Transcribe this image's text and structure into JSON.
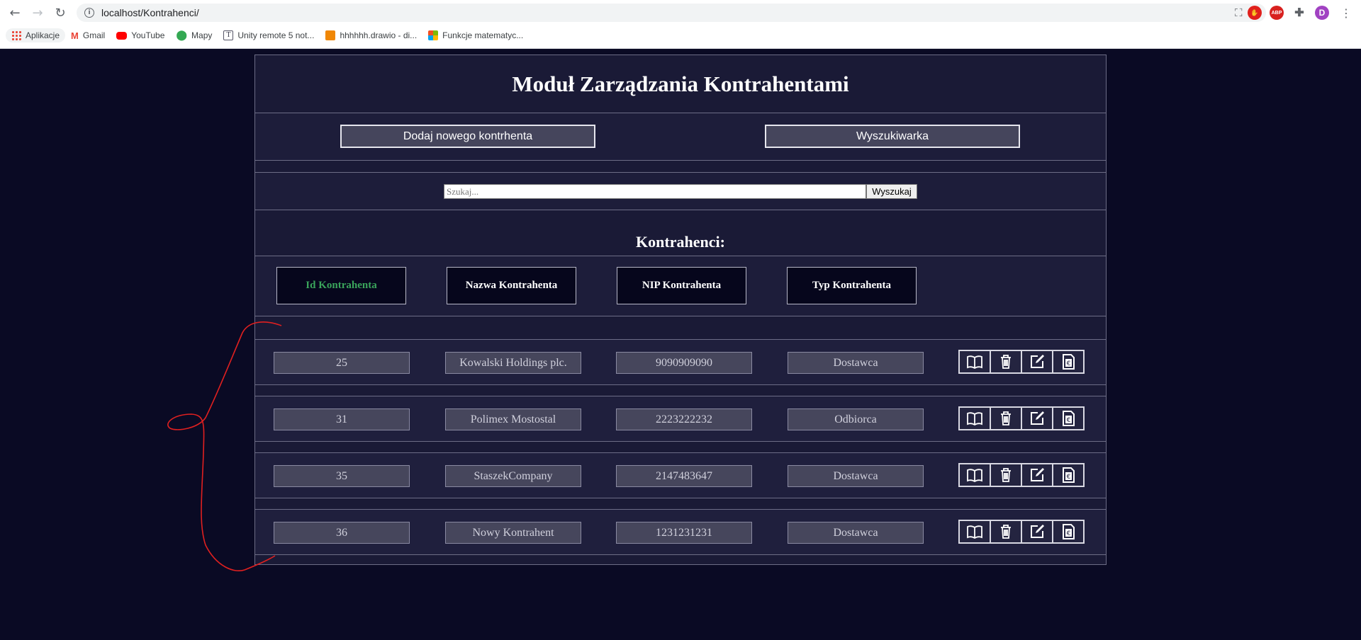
{
  "browser": {
    "url": "localhost/Kontrahenci/",
    "profile_initial": "D",
    "abp_label": "ABP",
    "bookmarks": [
      {
        "label": "Aplikacje"
      },
      {
        "label": "Gmail"
      },
      {
        "label": "YouTube"
      },
      {
        "label": "Mapy"
      },
      {
        "label": "Unity remote 5 not..."
      },
      {
        "label": "hhhhhh.drawio - di..."
      },
      {
        "label": "Funkcje matematyc..."
      }
    ]
  },
  "page": {
    "title": "Moduł Zarządzania Kontrahentami",
    "add_button": "Dodaj nowego kontrhenta",
    "search_engine_button": "Wyszukiwarka",
    "search_placeholder": "Szukaj...",
    "search_button": "Wyszukaj",
    "list_heading": "Kontrahenci:",
    "columns": [
      {
        "label": "Id Kontrahenta",
        "active": true
      },
      {
        "label": "Nazwa Kontrahenta",
        "active": false
      },
      {
        "label": "NIP Kontrahenta",
        "active": false
      },
      {
        "label": "Typ Kontrahenta",
        "active": false
      }
    ],
    "rows": [
      {
        "id": "25",
        "name": "Kowalski Holdings plc.",
        "nip": "9090909090",
        "type": "Dostawca"
      },
      {
        "id": "31",
        "name": "Polimex Mostostal",
        "nip": "2223222232",
        "type": "Odbiorca"
      },
      {
        "id": "35",
        "name": "StaszekCompany",
        "nip": "2147483647",
        "type": "Dostawca"
      },
      {
        "id": "36",
        "name": "Nowy Kontrahent",
        "nip": "1231231231",
        "type": "Dostawca"
      }
    ],
    "row_actions": [
      "book-icon",
      "trash-icon",
      "edit-icon",
      "invoice-icon"
    ]
  },
  "colors": {
    "page_bg": "#0a0a24",
    "panel_bg": "#1a1a36",
    "active_column": "#3aa45b",
    "scribble": "#e02020"
  }
}
